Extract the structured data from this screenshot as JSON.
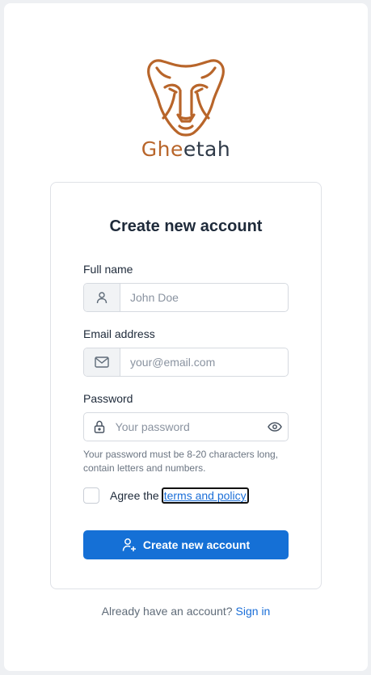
{
  "brand": {
    "name_highlight": "Ghe",
    "name_rest": "etah",
    "accent_color": "#b8652a"
  },
  "form": {
    "title": "Create new account",
    "full_name": {
      "label": "Full name",
      "placeholder": "John Doe",
      "icon": "user-icon"
    },
    "email": {
      "label": "Email address",
      "placeholder": "your@email.com",
      "icon": "envelope-icon"
    },
    "password": {
      "label": "Password",
      "placeholder": "Your password",
      "icon": "lock-icon",
      "toggle_icon": "eye-icon",
      "hint": "Your password must be 8-20 characters long, contain letters and numbers."
    },
    "agree": {
      "text": "Agree the",
      "link": "terms and policy"
    },
    "submit": {
      "label": "Create new account",
      "icon": "user-plus-icon",
      "color": "#1570d6"
    }
  },
  "footer": {
    "text": "Already have an account?",
    "link": "Sign in"
  }
}
